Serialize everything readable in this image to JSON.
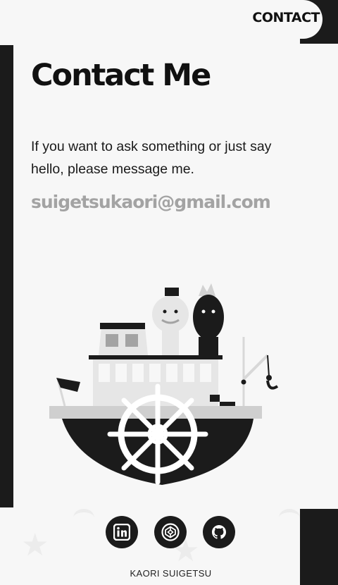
{
  "nav": {
    "contact_label": "CONTACT"
  },
  "main": {
    "title": "Contact Me",
    "intro": "If you want to ask something or just say hello, please message me.",
    "email": "suigetsukaori@gmail.com"
  },
  "illustration": {
    "subject": "boat-illustration"
  },
  "social": [
    {
      "icon": "linkedin-icon"
    },
    {
      "icon": "codepen-icon"
    },
    {
      "icon": "github-icon"
    }
  ],
  "footer": {
    "name": "KAORI SUIGETSU"
  },
  "colors": {
    "background": "#f7f7f7",
    "dark": "#1b1b1b",
    "email": "#a3a3a3",
    "illustration_light": "#e6e6e6"
  }
}
